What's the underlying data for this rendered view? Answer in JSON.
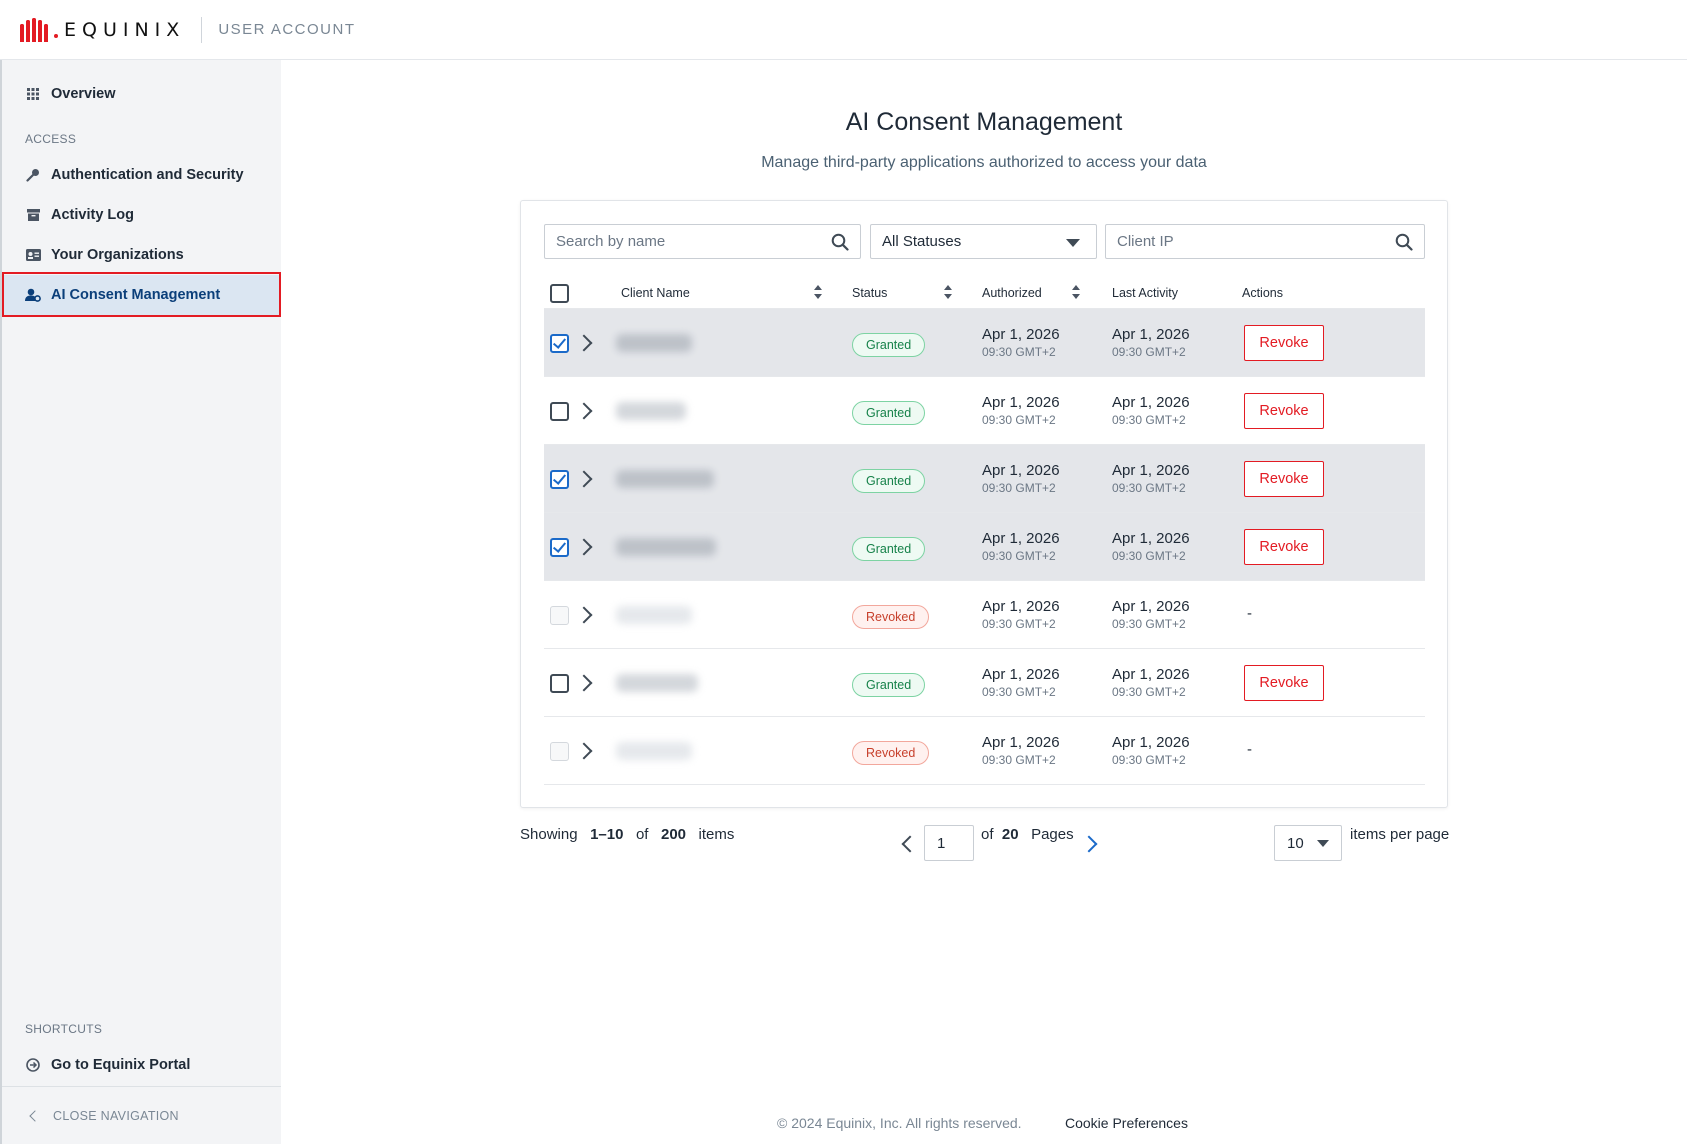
{
  "header": {
    "brand": "EQUINIX",
    "app_title": "USER ACCOUNT"
  },
  "sidebar": {
    "overview": "Overview",
    "access_section": "ACCESS",
    "items": [
      {
        "label": "Authentication and Security",
        "icon": "key-icon"
      },
      {
        "label": "Activity Log",
        "icon": "archive-icon"
      },
      {
        "label": "Your Organizations",
        "icon": "id-card-icon"
      },
      {
        "label": "AI Consent Management",
        "icon": "user-settings-icon",
        "active": true
      }
    ],
    "shortcuts_section": "SHORTCUTS",
    "portal_link": "Go to Equinix Portal",
    "close_nav": "CLOSE NAVIGATION"
  },
  "main": {
    "title": "AI Consent Management",
    "subtitle": "Manage third-party applications authorized to access your data"
  },
  "filters": {
    "search_placeholder": "Search by name",
    "status_selected": "All Statuses",
    "ip_placeholder": "Client IP"
  },
  "table": {
    "columns": {
      "client_name": "Client Name",
      "status": "Status",
      "authorized": "Authorized",
      "last_activity": "Last Activity",
      "actions": "Actions"
    },
    "action_label": "Revoke",
    "no_action": "-",
    "rows": [
      {
        "checked": true,
        "status": "Granted",
        "auth_date": "Apr 1, 2026",
        "auth_time": "09:30 GMT+2",
        "last_date": "Apr 1, 2026",
        "last_time": "09:30 GMT+2"
      },
      {
        "checked": false,
        "status": "Granted",
        "auth_date": "Apr 1, 2026",
        "auth_time": "09:30 GMT+2",
        "last_date": "Apr 1, 2026",
        "last_time": "09:30 GMT+2"
      },
      {
        "checked": true,
        "status": "Granted",
        "auth_date": "Apr 1, 2026",
        "auth_time": "09:30 GMT+2",
        "last_date": "Apr 1, 2026",
        "last_time": "09:30 GMT+2"
      },
      {
        "checked": true,
        "status": "Granted",
        "auth_date": "Apr 1, 2026",
        "auth_time": "09:30 GMT+2",
        "last_date": "Apr 1, 2026",
        "last_time": "09:30 GMT+2"
      },
      {
        "checked": false,
        "disabled": true,
        "status": "Revoked",
        "auth_date": "Apr 1, 2026",
        "auth_time": "09:30 GMT+2",
        "last_date": "Apr 1, 2026",
        "last_time": "09:30 GMT+2"
      },
      {
        "checked": false,
        "status": "Granted",
        "auth_date": "Apr 1, 2026",
        "auth_time": "09:30 GMT+2",
        "last_date": "Apr 1, 2026",
        "last_time": "09:30 GMT+2"
      },
      {
        "checked": false,
        "disabled": true,
        "status": "Revoked",
        "auth_date": "Apr 1, 2026",
        "auth_time": "09:30 GMT+2",
        "last_date": "Apr 1, 2026",
        "last_time": "09:30 GMT+2"
      }
    ]
  },
  "pagination": {
    "showing": "Showing",
    "range": "1–10",
    "of": "of",
    "total": "200",
    "items": "items",
    "page": "1",
    "of_pages": "of",
    "page_count": "20",
    "pages": "Pages",
    "per_page_value": "10",
    "per_page_label": "items per page"
  },
  "footer": {
    "copyright": "© 2024 Equinix, Inc. All rights reserved.",
    "cookie": "Cookie Preferences"
  },
  "colors": {
    "brand_red": "#e31b23",
    "active_nav_bg": "#dbe6f2",
    "granted": "#17824a",
    "revoked": "#c7402c",
    "checkbox_blue": "#1b6ac9"
  }
}
